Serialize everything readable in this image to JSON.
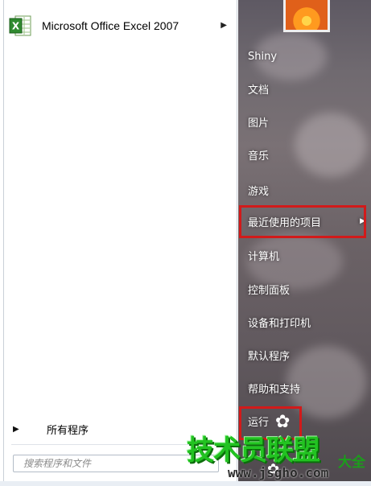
{
  "start_menu": {
    "pinned": {
      "label": "Microsoft Office Excel 2007",
      "icon": "excel-icon",
      "has_submenu": true
    },
    "all_programs": {
      "label": "所有程序",
      "icon": "triangle-right-icon"
    },
    "search": {
      "placeholder": "搜索程序和文件"
    },
    "right_items": [
      {
        "label": "Shiny"
      },
      {
        "label": "文档"
      },
      {
        "label": "图片"
      },
      {
        "label": "音乐"
      },
      {
        "label": "游戏"
      },
      {
        "label": "最近使用的项目",
        "has_submenu": true,
        "highlighted": true
      },
      {
        "label": "计算机"
      },
      {
        "label": "控制面板"
      },
      {
        "label": "设备和打印机"
      },
      {
        "label": "默认程序"
      },
      {
        "label": "帮助和支持"
      },
      {
        "label": "运行",
        "highlighted": true
      }
    ]
  },
  "watermark": {
    "main": "技术员联盟",
    "tail": "大全",
    "url": "www.jsgho.com"
  },
  "colors": {
    "highlight_border": "#d21a1a",
    "watermark_green": "#22c321",
    "right_pane": "#6b6266"
  }
}
